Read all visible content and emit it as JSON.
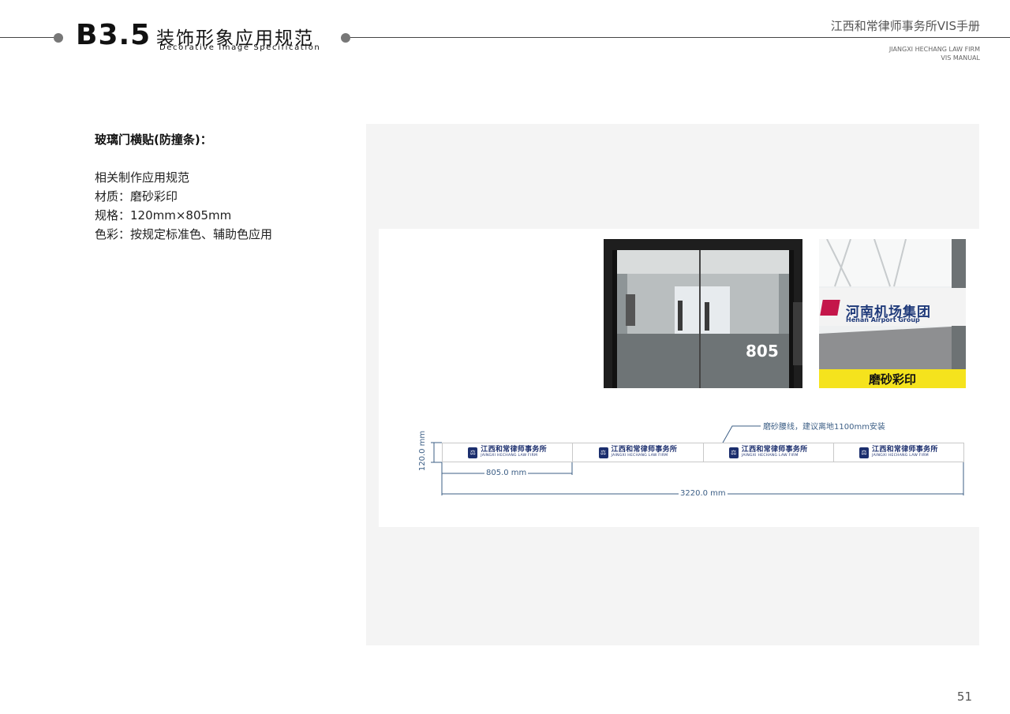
{
  "header": {
    "section_code": "B3.5",
    "title_cn": "装饰形象应用规范",
    "title_en": "Decorative Image   Specification",
    "manual_cn": "江西和常律师事务所VIS手册",
    "manual_en_line1": "JIANGXI HECHANG LAW FIRM",
    "manual_en_line2": "VIS MANUAL"
  },
  "left": {
    "section_title": "玻璃门横贴(防撞条)：",
    "specs": [
      "相关制作应用规范",
      "材质：磨砂彩印",
      "规格：120mm×805mm",
      "色彩：按规定标准色、辅助色应用"
    ]
  },
  "photos": {
    "door_label": "805",
    "sign_title": "河南机场集团",
    "sign_subtitle": "Henan  Airport Group",
    "sign_caption": "磨砂彩印"
  },
  "diagram": {
    "note": "磨砂腰线，建议离地1100mm安装",
    "height_dim": "120.0 mm",
    "segment_dim": "805.0 mm",
    "total_dim": "3220.0 mm",
    "segments": [
      {
        "cn": "江西和常律师事务所",
        "en": "JAINGXI HECHANG LAW FIRM"
      },
      {
        "cn": "江西和常律师事务所",
        "en": "JAINGXI HECHANG LAW FIRM"
      },
      {
        "cn": "江西和常律师事务所",
        "en": "JAINGXI HECHANG LAW FIRM"
      },
      {
        "cn": "江西和常律师事务所",
        "en": "JAINGXI HECHANG LAW FIRM"
      }
    ]
  },
  "footer": {
    "page_number": "51"
  },
  "colors": {
    "brand_navy": "#1c2f6e",
    "caption_yellow": "#f5e31d",
    "dimension_blue": "#3d5f86"
  }
}
